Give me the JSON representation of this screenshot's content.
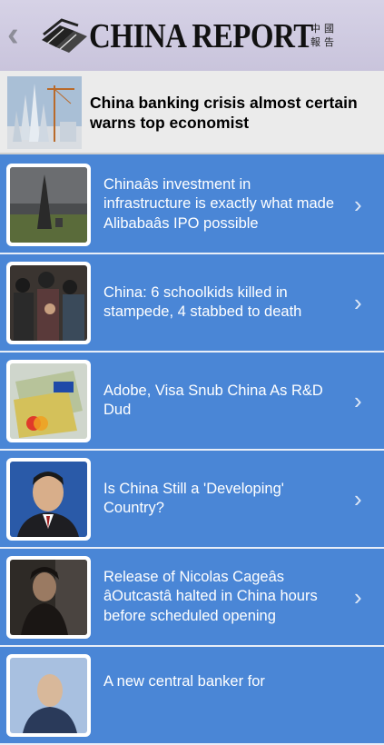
{
  "header": {
    "back_icon": "chevron-left-icon",
    "logo_text": "CHINA REPORT",
    "logo_chinese": "中國報告"
  },
  "featured": {
    "title": "China banking crisis almost certain warns top economist"
  },
  "articles": [
    {
      "title": "Chinaâs investment in infrastructure is exactly what made Alibabaâs IPO possible",
      "chevron": "›"
    },
    {
      "title": "China: 6 schoolkids killed in stampede, 4 stabbed to death",
      "chevron": "›"
    },
    {
      "title": "Adobe, Visa Snub China As R&D Dud",
      "chevron": "›"
    },
    {
      "title": "Is China Still a 'Developing' Country?",
      "chevron": "›"
    },
    {
      "title": "Release of Nicolas Cageâs âOutcastâ halted in China hours before scheduled opening",
      "chevron": "›"
    },
    {
      "title": "A new central banker for",
      "chevron": "›"
    }
  ],
  "colors": {
    "list_background": "#4a86d6",
    "header_background": "#d6d2e6",
    "featured_background": "#ebebeb"
  }
}
